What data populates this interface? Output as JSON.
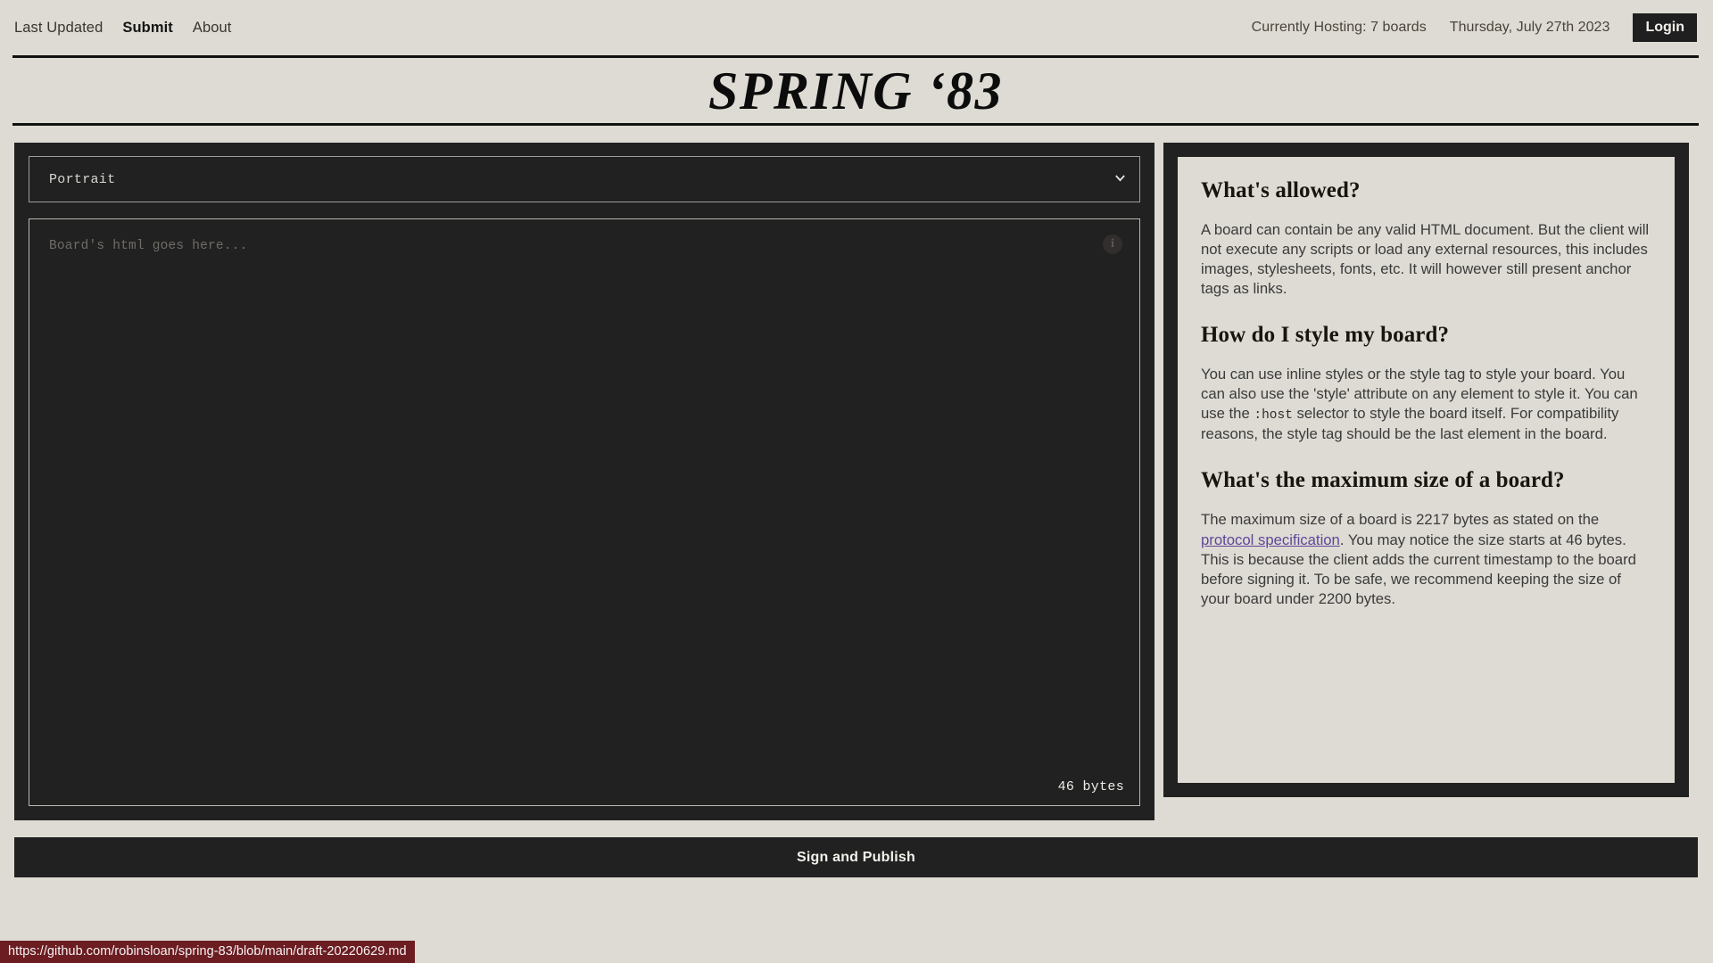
{
  "nav": {
    "links": [
      {
        "label": "Last Updated",
        "active": false
      },
      {
        "label": "Submit",
        "active": true
      },
      {
        "label": "About",
        "active": false
      }
    ],
    "hosting": "Currently Hosting: 7 boards",
    "date": "Thursday, July 27th 2023",
    "login_label": "Login"
  },
  "masthead": {
    "title": "SPRING ‘83"
  },
  "editor": {
    "select_value": "Portrait",
    "select_icon": "chevron-down-icon",
    "placeholder": "Board's html goes here...",
    "info_icon": "info-icon",
    "info_glyph": "i",
    "byte_count": "46 bytes"
  },
  "help": {
    "sections": [
      {
        "heading": "What's allowed?",
        "body_before": "A board can contain be any valid HTML document. But the client will not execute any scripts or load any external resources, this includes images, stylesheets, fonts, etc. It will however still present anchor tags as links.",
        "code": "",
        "body_after": "",
        "link_text": "",
        "body_tail": ""
      },
      {
        "heading": "How do I style my board?",
        "body_before": "You can use inline styles or the style tag to style your board. You can also use the 'style' attribute on any element to style it. You can use the ",
        "code": ":host",
        "body_after": " selector to style the board itself. For compatibility reasons, the style tag should be the last element in the board.",
        "link_text": "",
        "body_tail": ""
      },
      {
        "heading": "What's the maximum size of a board?",
        "body_before": "The maximum size of a board is 2217 bytes as stated on the ",
        "code": "",
        "body_after": "",
        "link_text": "protocol specification",
        "body_tail": ". You may notice the size starts at 46 bytes. This is because the client adds the current timestamp to the board before signing it. To be safe, we recommend keeping the size of your board under 2200 bytes."
      }
    ]
  },
  "publish": {
    "label": "Sign and Publish"
  },
  "statusbar": {
    "url": "https://github.com/robinsloan/spring-83/blob/main/draft-20220629.md"
  },
  "colors": {
    "page_bg": "#dddbd3",
    "panel_dark": "#212121",
    "link": "#61469a",
    "status_bg": "#6b1d22"
  }
}
